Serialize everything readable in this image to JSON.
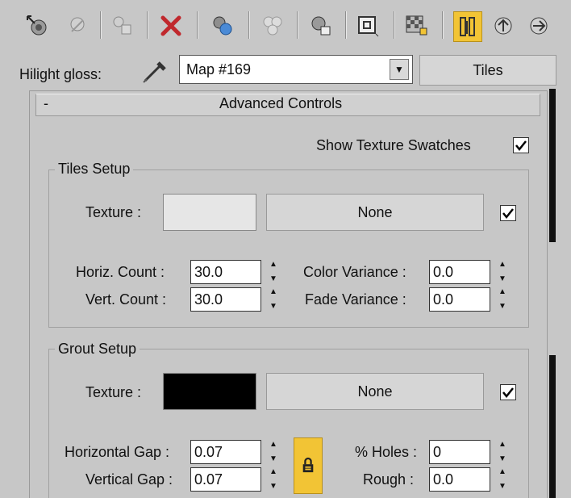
{
  "hilight": {
    "label": "Hilight gloss:",
    "map_value": "Map #169",
    "tiles_button": "Tiles"
  },
  "rollout": {
    "collapse_symbol": "-",
    "title": "Advanced Controls"
  },
  "show_swatches": {
    "label": "Show Texture Swatches",
    "checked": true
  },
  "tiles_setup": {
    "title": "Tiles Setup",
    "texture_label": "Texture :",
    "texture_button": "None",
    "horiz_count_label": "Horiz. Count :",
    "horiz_count": "30.0",
    "vert_count_label": "Vert. Count :",
    "vert_count": "30.0",
    "color_variance_label": "Color Variance :",
    "color_variance": "0.0",
    "fade_variance_label": "Fade Variance :",
    "fade_variance": "0.0"
  },
  "grout_setup": {
    "title": "Grout Setup",
    "texture_label": "Texture :",
    "texture_button": "None",
    "horizontal_gap_label": "Horizontal Gap :",
    "horizontal_gap": "0.07",
    "vertical_gap_label": "Vertical Gap :",
    "vertical_gap": "0.07",
    "holes_label": "% Holes :",
    "holes": "0",
    "rough_label": "Rough :",
    "rough": "0.0"
  },
  "colors": {
    "accent": "#f2c435",
    "tiles_swatch": "#e6e6e6",
    "grout_swatch": "#000000"
  }
}
